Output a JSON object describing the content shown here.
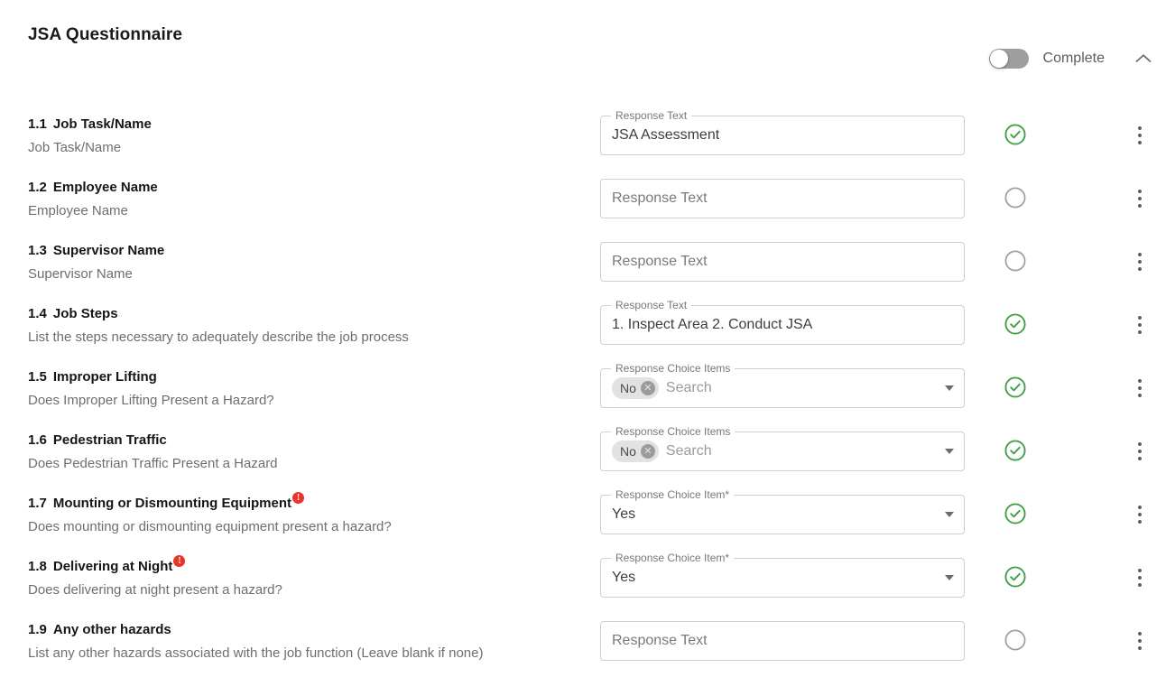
{
  "header": {
    "title": "JSA Questionnaire",
    "complete_label": "Complete",
    "toggle_state": "off",
    "collapse_icon": "chevron-up-icon"
  },
  "colors": {
    "status_complete": "#43a047",
    "status_incomplete": "#9e9e9e",
    "required_badge": "#e8342a",
    "chip_background": "#e2e2e2",
    "border": "#cfcfcf"
  },
  "rows": [
    {
      "number": "1.1",
      "title": "Job Task/Name",
      "description": "Job Task/Name",
      "required": false,
      "field_type": "text",
      "notch_label": "Response Text",
      "value": "JSA Assessment",
      "placeholder": "Response Text",
      "status": "complete"
    },
    {
      "number": "1.2",
      "title": "Employee Name",
      "description": "Employee Name",
      "required": false,
      "field_type": "text",
      "notch_label": "",
      "value": "",
      "placeholder": "Response Text",
      "status": "incomplete"
    },
    {
      "number": "1.3",
      "title": "Supervisor Name",
      "description": "Supervisor Name",
      "required": false,
      "field_type": "text",
      "notch_label": "",
      "value": "",
      "placeholder": "Response Text",
      "status": "incomplete"
    },
    {
      "number": "1.4",
      "title": "Job Steps",
      "description": "List the steps necessary to adequately describe the job process",
      "required": false,
      "field_type": "text",
      "notch_label": "Response Text",
      "value": "1. Inspect Area 2. Conduct JSA",
      "placeholder": "Response Text",
      "status": "complete"
    },
    {
      "number": "1.5",
      "title": "Improper Lifting",
      "description": "Does Improper Lifting Present a Hazard?",
      "required": false,
      "field_type": "multiselect",
      "notch_label": "Response Choice Items",
      "chips": [
        "No"
      ],
      "placeholder": "Search",
      "status": "complete"
    },
    {
      "number": "1.6",
      "title": "Pedestrian Traffic",
      "description": "Does Pedestrian Traffic Present a Hazard",
      "required": false,
      "field_type": "multiselect",
      "notch_label": "Response Choice Items",
      "chips": [
        "No"
      ],
      "placeholder": "Search",
      "status": "complete"
    },
    {
      "number": "1.7",
      "title": "Mounting or Dismounting Equipment",
      "description": "Does mounting or dismounting equipment present a hazard?",
      "required": true,
      "field_type": "select",
      "notch_label": "Response Choice Item*",
      "value": "Yes",
      "placeholder": "",
      "status": "complete"
    },
    {
      "number": "1.8",
      "title": "Delivering at Night",
      "description": "Does delivering at night present a hazard?",
      "required": true,
      "field_type": "select",
      "notch_label": "Response Choice Item*",
      "value": "Yes",
      "placeholder": "",
      "status": "complete"
    },
    {
      "number": "1.9",
      "title": "Any other hazards",
      "description": "List any other hazards associated with the job function (Leave blank if none)",
      "required": false,
      "field_type": "text",
      "notch_label": "",
      "value": "",
      "placeholder": "Response Text",
      "status": "incomplete"
    }
  ]
}
